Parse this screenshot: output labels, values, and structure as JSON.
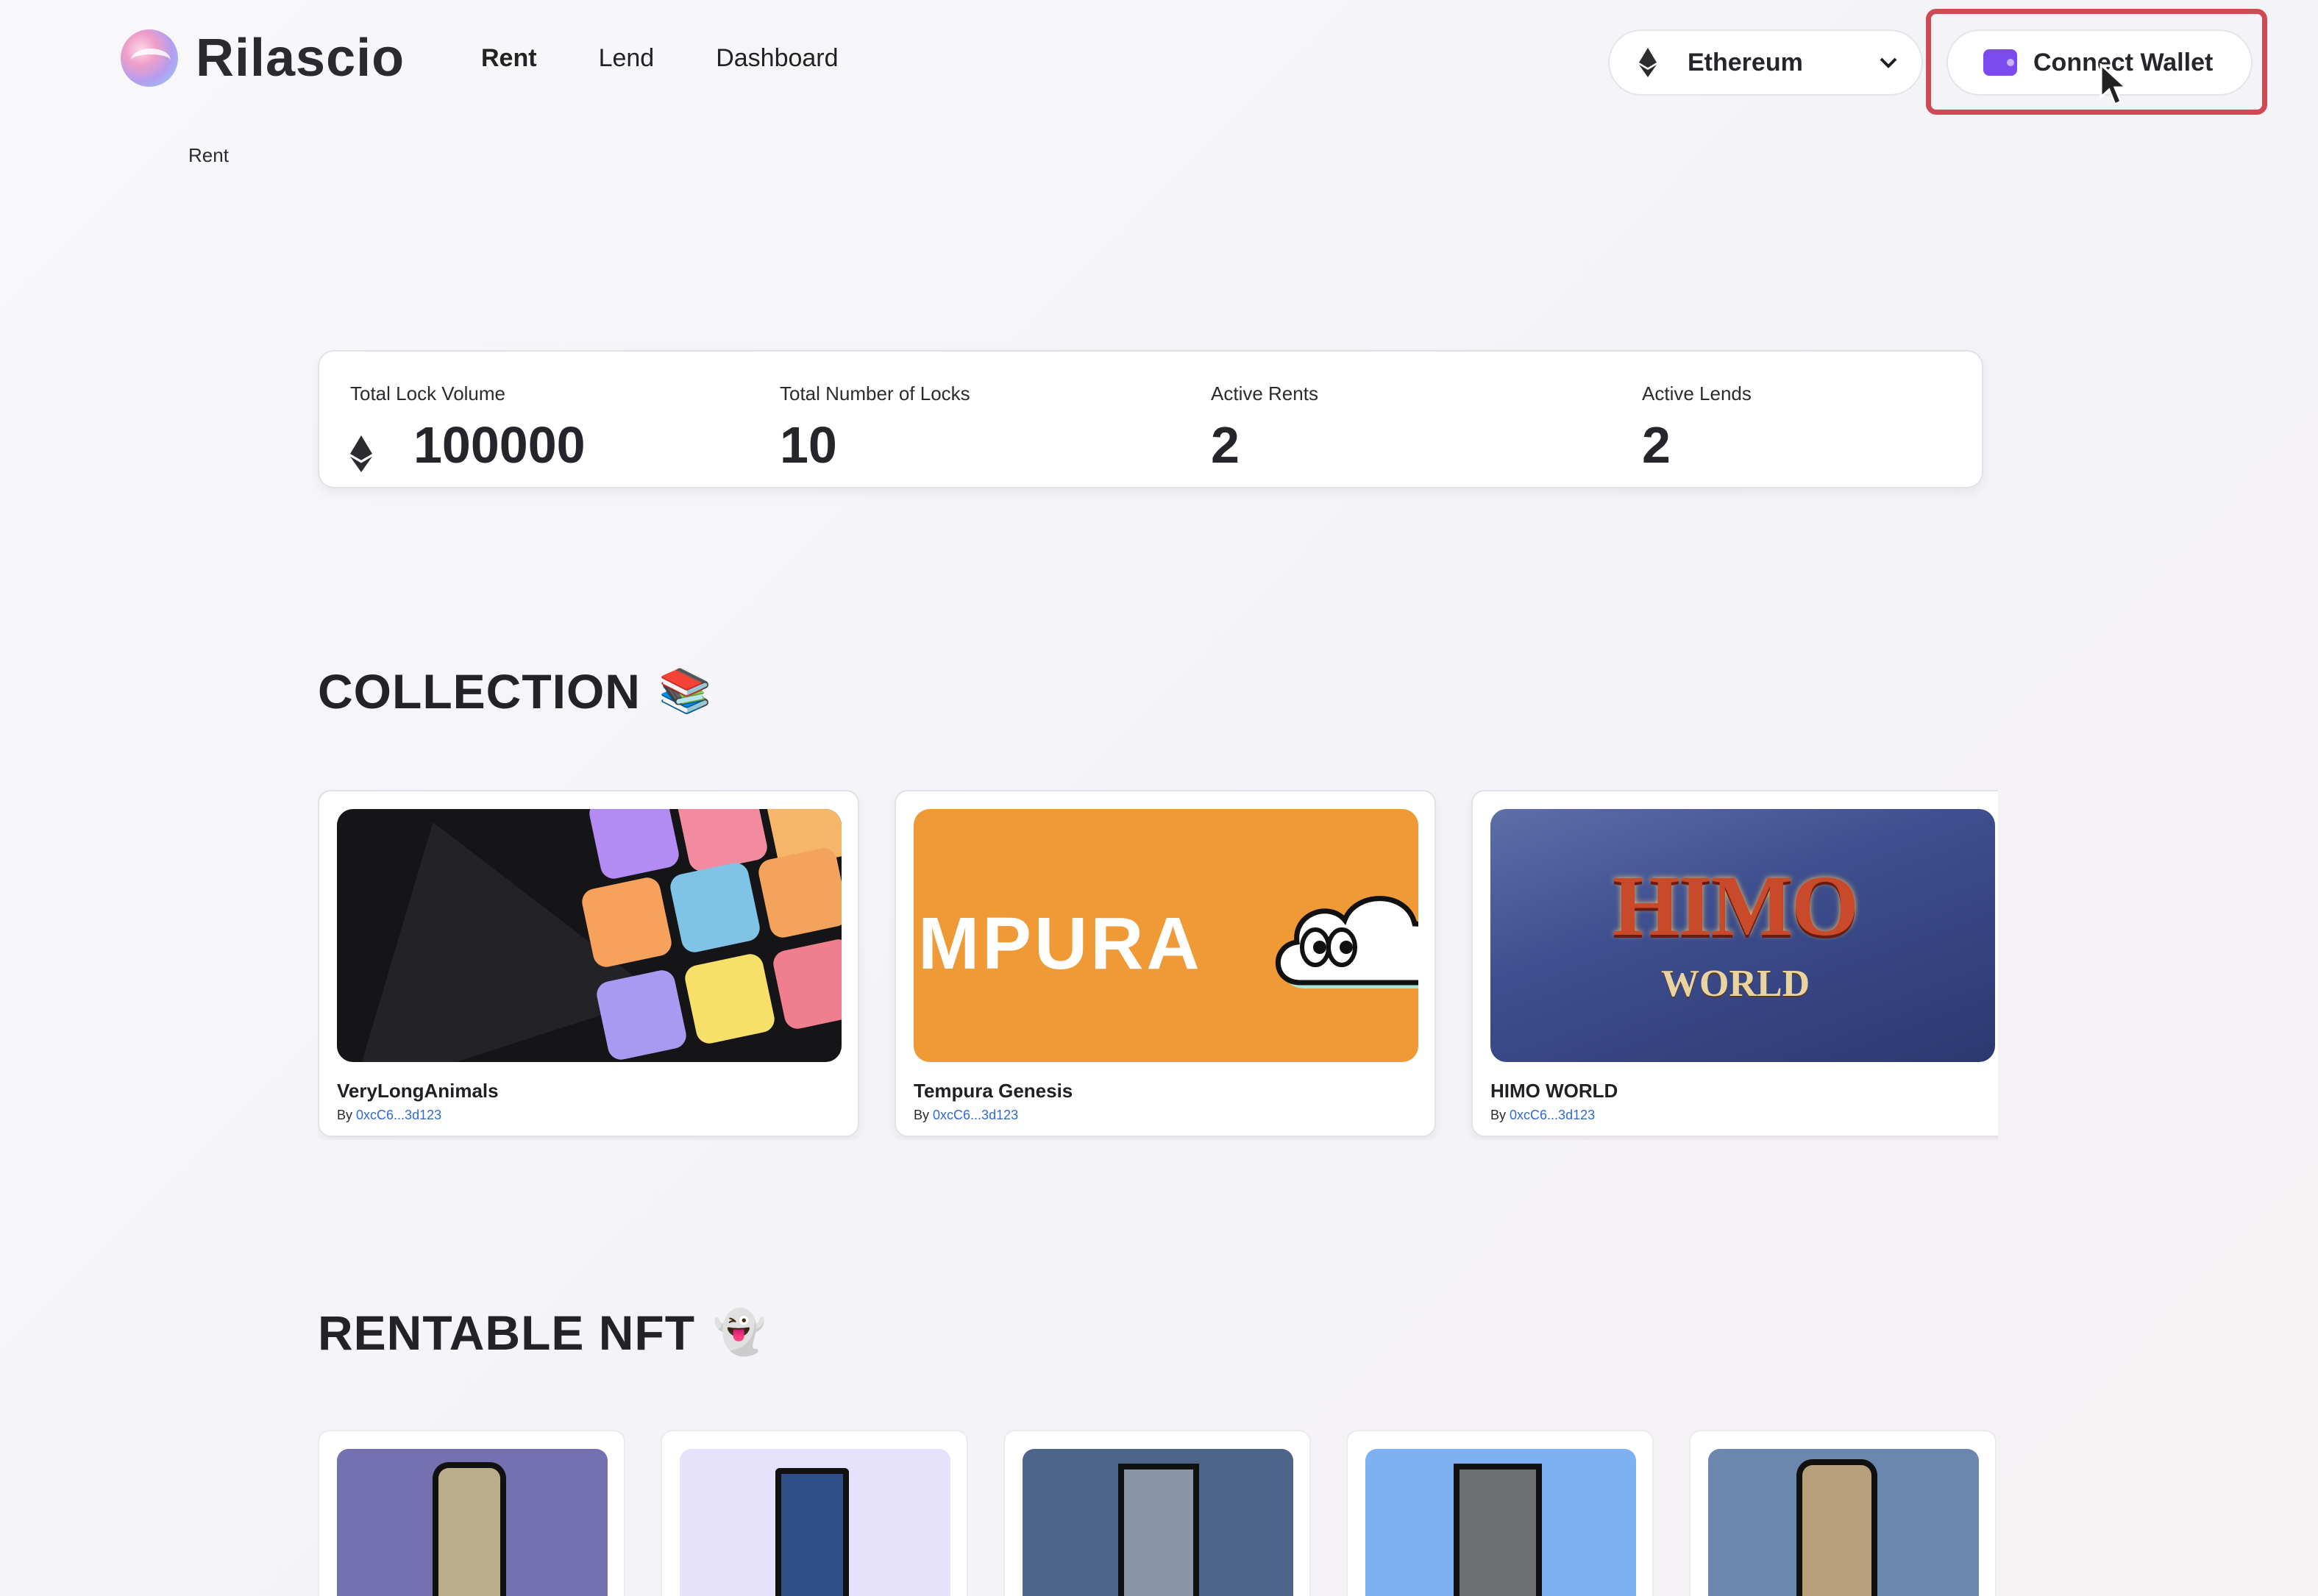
{
  "app": {
    "name": "Rilascio"
  },
  "nav": {
    "items": [
      "Rent",
      "Lend",
      "Dashboard"
    ],
    "active": "Rent"
  },
  "network": {
    "selected": "Ethereum",
    "icon": "ethereum-icon"
  },
  "wallet": {
    "connect_label": "Connect Wallet",
    "icon": "wallet-icon",
    "accent": "#7b4bf0"
  },
  "breadcrumb": {
    "current": "Rent"
  },
  "stats": [
    {
      "label": "Total Lock Volume",
      "value": "100000",
      "icon": "ethereum-icon"
    },
    {
      "label": "Total Number of Locks",
      "value": "10"
    },
    {
      "label": "Active Rents",
      "value": "2"
    },
    {
      "label": "Active Lends",
      "value": "2"
    }
  ],
  "collection": {
    "title": "COLLECTION",
    "emoji": "📚",
    "cards": [
      {
        "name": "VeryLongAnimals",
        "by_label": "By",
        "owner": "0xcC6...3d123"
      },
      {
        "name": "Tempura Genesis",
        "by_label": "By",
        "owner": "0xcC6...3d123",
        "banner_text": "MPURA"
      },
      {
        "name": "HIMO WORLD",
        "by_label": "By",
        "owner": "0xcC6...3d123",
        "banner_text": "HIMO",
        "banner_subtext": "WORLD"
      }
    ]
  },
  "rentable": {
    "title": "RENTABLE NFT",
    "emoji": "👻",
    "cards": [
      {
        "bg": "#7570b0",
        "body": "#b9ad8c"
      },
      {
        "bg": "#e6e2fb",
        "body": "#2f4d86"
      },
      {
        "bg": "#4d6589",
        "body": "#8896a8"
      },
      {
        "bg": "#7eb1f2",
        "body": "#6d6f72"
      },
      {
        "bg": "#6c87ad",
        "body": "#b8a07a"
      }
    ]
  },
  "colors": {
    "highlight": "#d04a55",
    "link": "#2f6bd8",
    "tempura": "#ef9a36"
  }
}
